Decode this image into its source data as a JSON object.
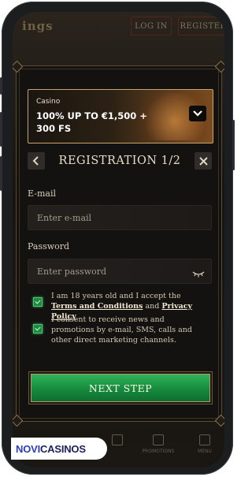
{
  "header": {
    "logo_text": "ings",
    "login_label": "LOG IN",
    "register_label": "REGISTER"
  },
  "promo": {
    "label": "Casino",
    "title": "100% UP TO €1,500 + 300 FS",
    "toggle_icon": "chevron-down-icon"
  },
  "registration": {
    "title": "REGISTRATION 1/2",
    "back_icon": "chevron-left-icon",
    "close_icon": "close-icon"
  },
  "form": {
    "email_label": "E-mail",
    "email_placeholder": "Enter e-mail",
    "password_label": "Password",
    "password_placeholder": "Enter password",
    "password_toggle_icon": "eye-closed-icon"
  },
  "consents": {
    "age_prefix": "I am 18 years old and I accept the",
    "terms_link": "Terms and Conditions",
    "and_text": "and",
    "privacy_link": "Privacy Policy",
    "marketing_text": "I consent to receive news and promotions by e-mail, SMS, calls and other direct marketing channels.",
    "age_checked": true,
    "marketing_checked": true
  },
  "next_button": "NEXT STEP",
  "bottom_nav": {
    "items": [
      "",
      "",
      "",
      "PROMOTIONS",
      "MENU"
    ]
  },
  "watermark": {
    "part1": "NOVI",
    "part2": "CASINOS",
    "color1": "#2d3bbf",
    "color2": "#1b1f5e"
  }
}
